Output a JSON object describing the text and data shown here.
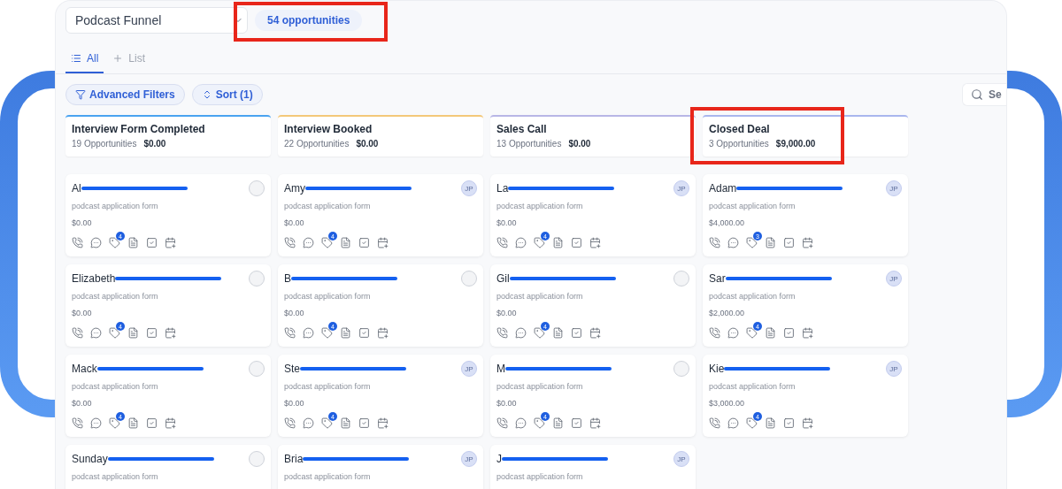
{
  "pipeline_select": {
    "value": "Podcast Funnel"
  },
  "opportunity_count": {
    "label": "54 opportunities",
    "highlighted": true
  },
  "tabs": [
    {
      "label": "All",
      "selected": true,
      "kind": "view"
    },
    {
      "label": "List",
      "selected": false,
      "kind": "add"
    }
  ],
  "filters": [
    {
      "label": "Advanced Filters",
      "kind": "filter"
    },
    {
      "label": "Sort (1)",
      "kind": "sort"
    }
  ],
  "search": {
    "placeholder": "Se"
  },
  "stages": [
    {
      "title": "Interview Form Completed",
      "count": "19 Opportunities",
      "total": "$0.00",
      "color": "#4aa3f0",
      "highlighted": false,
      "cards": [
        {
          "name": "Al",
          "redacted": true,
          "source": "podcast application form",
          "value": "$0.00",
          "tag_count": "4"
        },
        {
          "name": "Elizabeth",
          "redacted": true,
          "source": "podcast application form",
          "value": "$0.00",
          "tag_count": "4"
        },
        {
          "name": "Mack",
          "redacted": true,
          "source": "podcast application form",
          "value": "$0.00",
          "tag_count": "4"
        },
        {
          "name": "Sunday",
          "redacted": true,
          "source": "podcast application form"
        }
      ]
    },
    {
      "title": "Interview Booked",
      "count": "22 Opportunities",
      "total": "$0.00",
      "color": "#f3c879",
      "highlighted": false,
      "cards": [
        {
          "name": "Amy",
          "redacted": true,
          "assignee": "JP",
          "source": "podcast application form",
          "value": "$0.00",
          "tag_count": "4"
        },
        {
          "name": "B",
          "redacted": true,
          "source": "podcast application form",
          "value": "$0.00",
          "tag_count": "4"
        },
        {
          "name": "Ste",
          "redacted": true,
          "assignee": "JP",
          "source": "podcast application form",
          "value": "$0.00",
          "tag_count": "4"
        },
        {
          "name": "Bria",
          "redacted": true,
          "assignee": "JP",
          "source": "podcast application form"
        }
      ]
    },
    {
      "title": "Sales Call",
      "count": "13 Opportunities",
      "total": "$0.00",
      "color": "#b8b6e6",
      "highlighted": false,
      "cards": [
        {
          "name": "La",
          "redacted": true,
          "assignee": "JP",
          "source": "podcast application form",
          "value": "$0.00",
          "tag_count": "4"
        },
        {
          "name": "Gil",
          "redacted": true,
          "source": "podcast application form",
          "value": "$0.00",
          "tag_count": "4"
        },
        {
          "name": "M",
          "redacted": true,
          "source": "podcast application form",
          "value": "$0.00",
          "tag_count": "4"
        },
        {
          "name": "J",
          "redacted": true,
          "assignee": "JP",
          "source": "podcast application form"
        }
      ]
    },
    {
      "title": "Closed Deal",
      "count": "3 Opportunities",
      "total": "$9,000.00",
      "color": "#a9b6ee",
      "highlighted": true,
      "cards": [
        {
          "name": "Adam",
          "redacted": true,
          "assignee": "JP",
          "source": "podcast application form",
          "value": "$4,000.00",
          "tag_count": "3"
        },
        {
          "name": "Sar",
          "redacted": true,
          "assignee": "JP",
          "source": "podcast application form",
          "value": "$2,000.00",
          "tag_count": "4"
        },
        {
          "name": "Kie",
          "redacted": true,
          "assignee": "JP",
          "source": "podcast application form",
          "value": "$3,000.00",
          "tag_count": "4"
        }
      ]
    }
  ]
}
